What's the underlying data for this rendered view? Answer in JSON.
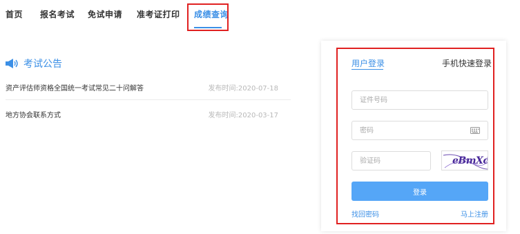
{
  "nav": {
    "items": [
      {
        "label": "首页"
      },
      {
        "label": "报名考试"
      },
      {
        "label": "免试申请"
      },
      {
        "label": "准考证打印"
      },
      {
        "label": "成绩查询",
        "active": true
      }
    ],
    "accent_color": "#3b8fe6",
    "highlight_color": "#e02020"
  },
  "announcements": {
    "title": "考试公告",
    "icon": "megaphone-icon",
    "items": [
      {
        "title": "资产评估师资格全国统一考试常见二十问解答",
        "date": "发布时间:2020-07-18"
      },
      {
        "title": "地方协会联系方式",
        "date": "发布时间:2020-03-17"
      }
    ]
  },
  "login": {
    "tabs": [
      {
        "label": "用户登录",
        "active": true
      },
      {
        "label": "手机快速登录"
      }
    ],
    "id_placeholder": "证件号码",
    "password_placeholder": "密码",
    "captcha_placeholder": "验证码",
    "captcha_text": "eBmXc",
    "submit_label": "登录",
    "forgot_label": "找回密码",
    "register_label": "马上注册",
    "button_color": "#55a6f7"
  }
}
